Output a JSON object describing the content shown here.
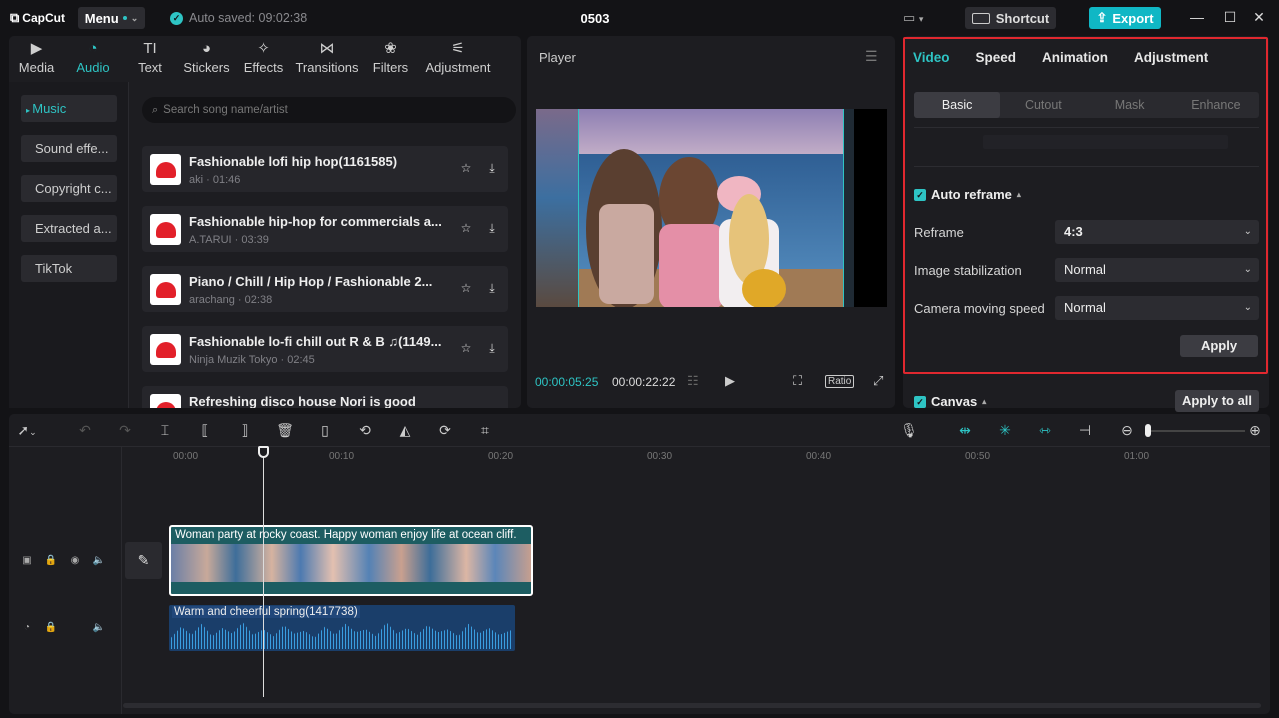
{
  "app": {
    "name": "CapCut",
    "menu_label": "Menu",
    "autosave": "Auto saved: 09:02:38",
    "project_title": "0503",
    "shortcut_label": "Shortcut",
    "export_label": "Export",
    "accent": "#2ec4c4",
    "highlight_color": "#e0282f"
  },
  "media_tabs": [
    {
      "label": "Media",
      "icon": "media-icon"
    },
    {
      "label": "Audio",
      "icon": "audio-icon",
      "active": true
    },
    {
      "label": "Text",
      "icon": "text-icon",
      "glyph": "TI"
    },
    {
      "label": "Stickers",
      "icon": "stickers-icon"
    },
    {
      "label": "Effects",
      "icon": "effects-icon"
    },
    {
      "label": "Transitions",
      "icon": "transitions-icon"
    },
    {
      "label": "Filters",
      "icon": "filters-icon"
    },
    {
      "label": "Adjustment",
      "icon": "adjustment-icon"
    }
  ],
  "audio_nav": [
    "Music",
    "Sound effe...",
    "Copyright c...",
    "Extracted a...",
    "TikTok"
  ],
  "search": {
    "placeholder": "Search song name/artist"
  },
  "tracks": [
    {
      "title": "Fashionable lofi hip hop(1161585)",
      "artist": "aki",
      "duration": "01:46"
    },
    {
      "title": "Fashionable hip-hop for commercials a...",
      "artist": "A.TARUI",
      "duration": "03:39"
    },
    {
      "title": "Piano / Chill / Hip Hop / Fashionable 2...",
      "artist": "arachang",
      "duration": "02:38"
    },
    {
      "title": "Fashionable lo-fi chill out R & B ♫(1149...",
      "artist": "Ninja Muzik Tokyo",
      "duration": "02:45"
    },
    {
      "title": "Refreshing disco house Nori is good",
      "artist": "",
      "duration": ""
    }
  ],
  "player": {
    "title": "Player",
    "current_time": "00:00:05:25",
    "total_time": "00:00:22:22",
    "ratio_label": "Ratio"
  },
  "inspector": {
    "tabs": [
      "Video",
      "Speed",
      "Animation",
      "Adjustment"
    ],
    "subtabs": [
      "Basic",
      "Cutout",
      "Mask",
      "Enhance"
    ],
    "auto_reframe_label": "Auto reframe",
    "rows": [
      {
        "label": "Reframe",
        "value": "4:3"
      },
      {
        "label": "Image stabilization",
        "value": "Normal"
      },
      {
        "label": "Camera moving speed",
        "value": "Normal"
      }
    ],
    "apply_label": "Apply",
    "canvas_label": "Canvas",
    "apply_all_label": "Apply to all"
  },
  "timeline": {
    "ruler": [
      "00:00",
      "00:10",
      "00:20",
      "00:30",
      "00:40",
      "00:50",
      "01:00"
    ],
    "video_clip_label": "Woman party at rocky coast. Happy woman enjoy life at ocean cliff.",
    "audio_clip_label": "Warm and cheerful spring(1417738)"
  }
}
